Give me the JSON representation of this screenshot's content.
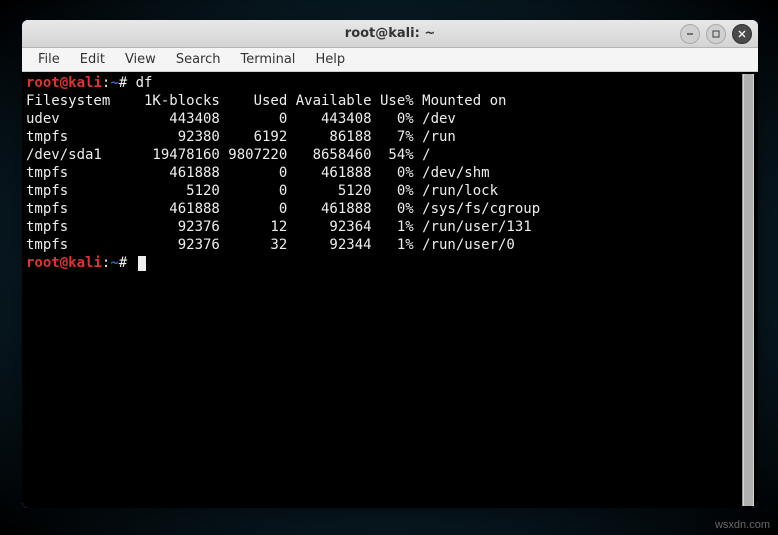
{
  "window": {
    "title": "root@kali: ~"
  },
  "menubar": {
    "items": [
      "File",
      "Edit",
      "View",
      "Search",
      "Terminal",
      "Help"
    ]
  },
  "prompt": {
    "user": "root",
    "at": "@",
    "host": "kali",
    "colon": ":",
    "tilde": "~",
    "hash": "#"
  },
  "command1": "df",
  "df": {
    "header": {
      "filesystem": "Filesystem",
      "blocks": "1K-blocks",
      "used": "Used",
      "available": "Available",
      "usepct": "Use%",
      "mounted": "Mounted on"
    },
    "rows": [
      {
        "fs": "udev",
        "blocks": "443408",
        "used": "0",
        "avail": "443408",
        "pct": "0%",
        "mount": "/dev"
      },
      {
        "fs": "tmpfs",
        "blocks": "92380",
        "used": "6192",
        "avail": "86188",
        "pct": "7%",
        "mount": "/run"
      },
      {
        "fs": "/dev/sda1",
        "blocks": "19478160",
        "used": "9807220",
        "avail": "8658460",
        "pct": "54%",
        "mount": "/"
      },
      {
        "fs": "tmpfs",
        "blocks": "461888",
        "used": "0",
        "avail": "461888",
        "pct": "0%",
        "mount": "/dev/shm"
      },
      {
        "fs": "tmpfs",
        "blocks": "5120",
        "used": "0",
        "avail": "5120",
        "pct": "0%",
        "mount": "/run/lock"
      },
      {
        "fs": "tmpfs",
        "blocks": "461888",
        "used": "0",
        "avail": "461888",
        "pct": "0%",
        "mount": "/sys/fs/cgroup"
      },
      {
        "fs": "tmpfs",
        "blocks": "92376",
        "used": "12",
        "avail": "92364",
        "pct": "1%",
        "mount": "/run/user/131"
      },
      {
        "fs": "tmpfs",
        "blocks": "92376",
        "used": "32",
        "avail": "92344",
        "pct": "1%",
        "mount": "/run/user/0"
      }
    ]
  },
  "watermark": "wsxdn.com"
}
